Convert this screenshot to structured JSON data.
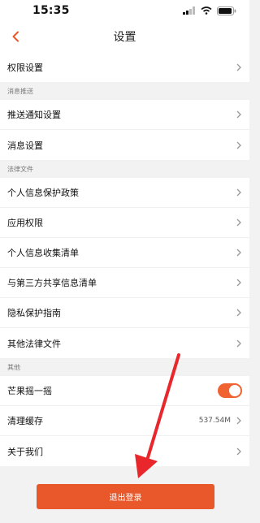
{
  "status_bar": {
    "time": "15:35"
  },
  "header": {
    "title": "设置"
  },
  "items": {
    "permissions": "权限设置",
    "push_settings": "推送通知设置",
    "message_settings": "消息设置",
    "privacy_policy": "个人信息保护政策",
    "app_permissions": "应用权限",
    "info_collection": "个人信息收集清单",
    "third_party": "与第三方共享信息清单",
    "privacy_guide": "隐私保护指南",
    "other_legal": "其他法律文件",
    "shake": "芒果摇一摇",
    "clear_cache": "清理缓存",
    "about": "关于我们"
  },
  "sections": {
    "push": "消息推送",
    "legal": "法律文件",
    "other": "其他"
  },
  "cache_size": "537.54M",
  "shake_toggle_on": true,
  "logout_label": "退出登录",
  "colors": {
    "accent": "#e8582a",
    "toggle": "#f0622f",
    "annotation_arrow": "#e8262b"
  }
}
